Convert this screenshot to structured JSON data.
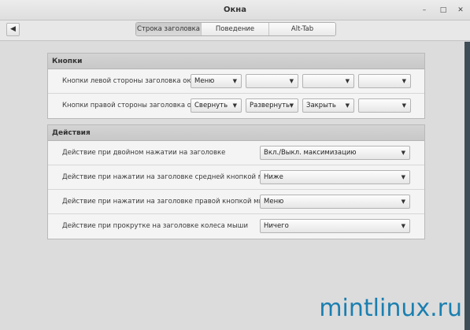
{
  "window": {
    "title": "Окна"
  },
  "toolbar": {
    "tabs": [
      {
        "label": "Строка заголовка",
        "active": true
      },
      {
        "label": "Поведение",
        "active": false
      },
      {
        "label": "Alt-Tab",
        "active": false
      }
    ]
  },
  "buttons_section": {
    "header": "Кнопки",
    "rows": [
      {
        "label": "Кнопки левой стороны заголовка окна",
        "values": [
          "Меню",
          "",
          "",
          ""
        ]
      },
      {
        "label": "Кнопки правой стороны заголовка окна",
        "values": [
          "Свернуть",
          "Развернуть",
          "Закрыть",
          ""
        ]
      }
    ]
  },
  "actions_section": {
    "header": "Действия",
    "rows": [
      {
        "label": "Действие при двойном нажатии на заголовке",
        "value": "Вкл./Выкл. максимизацию"
      },
      {
        "label": "Действие при нажатии на заголовке средней кнопкой мыши",
        "value": "Ниже"
      },
      {
        "label": "Действие при нажатии на заголовке правой кнопкой мыши",
        "value": "Меню"
      },
      {
        "label": "Действие при прокрутке на заголовке колеса мыши",
        "value": "Ничего"
      }
    ]
  },
  "watermark": "mintlinux.ru",
  "colors": {
    "accent": "#1a7fb0",
    "header_bg": "#cfcfcf"
  }
}
